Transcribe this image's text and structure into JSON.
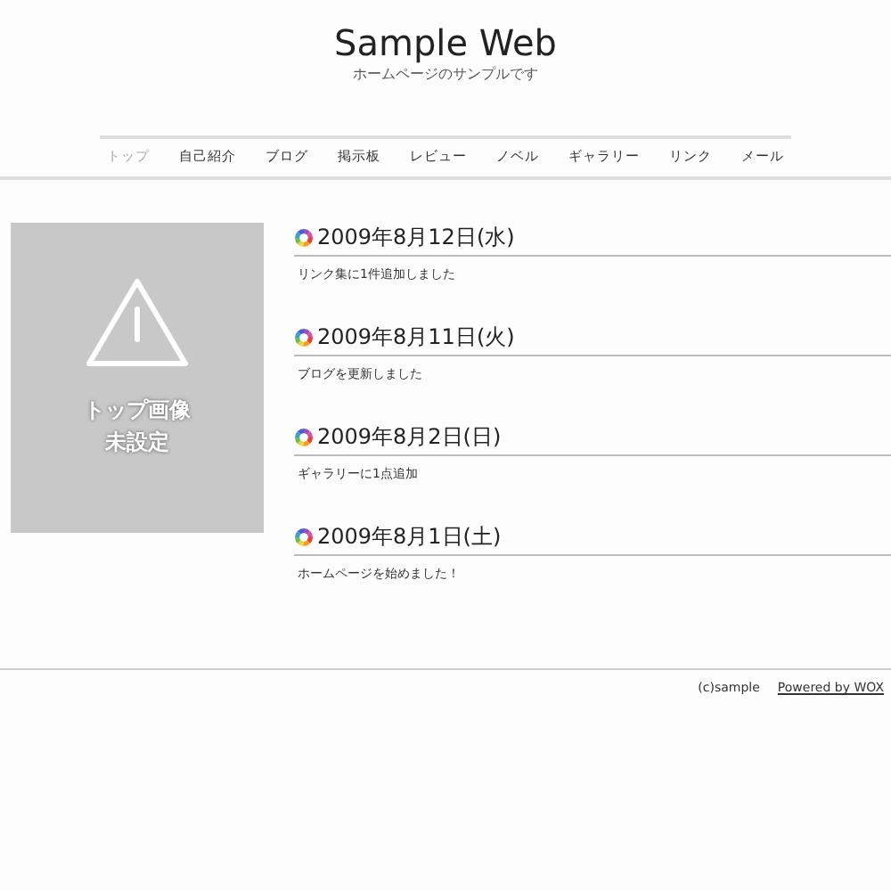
{
  "header": {
    "title": "Sample Web",
    "subtitle": "ホームページのサンプルです"
  },
  "nav": [
    {
      "label": "トップ",
      "selected": true
    },
    {
      "label": "自己紹介",
      "selected": false
    },
    {
      "label": "ブログ",
      "selected": false
    },
    {
      "label": "掲示板",
      "selected": false
    },
    {
      "label": "レビュー",
      "selected": false
    },
    {
      "label": "ノベル",
      "selected": false
    },
    {
      "label": "ギャラリー",
      "selected": false
    },
    {
      "label": "リンク",
      "selected": false
    },
    {
      "label": "メール",
      "selected": false
    }
  ],
  "top_image": {
    "caption": [
      "トップ画像",
      "未設定"
    ]
  },
  "entries": [
    {
      "date": "2009年8月12日(水)",
      "text": "リンク集に1件追加しました"
    },
    {
      "date": "2009年8月11日(火)",
      "text": "ブログを更新しました"
    },
    {
      "date": "2009年8月2日(日)",
      "text": "ギャラリーに1点追加"
    },
    {
      "date": "2009年8月1日(土)",
      "text": "ホームページを始めました！"
    }
  ],
  "footer": {
    "copyright": "(c)sample",
    "link": "Powered by WOX"
  }
}
